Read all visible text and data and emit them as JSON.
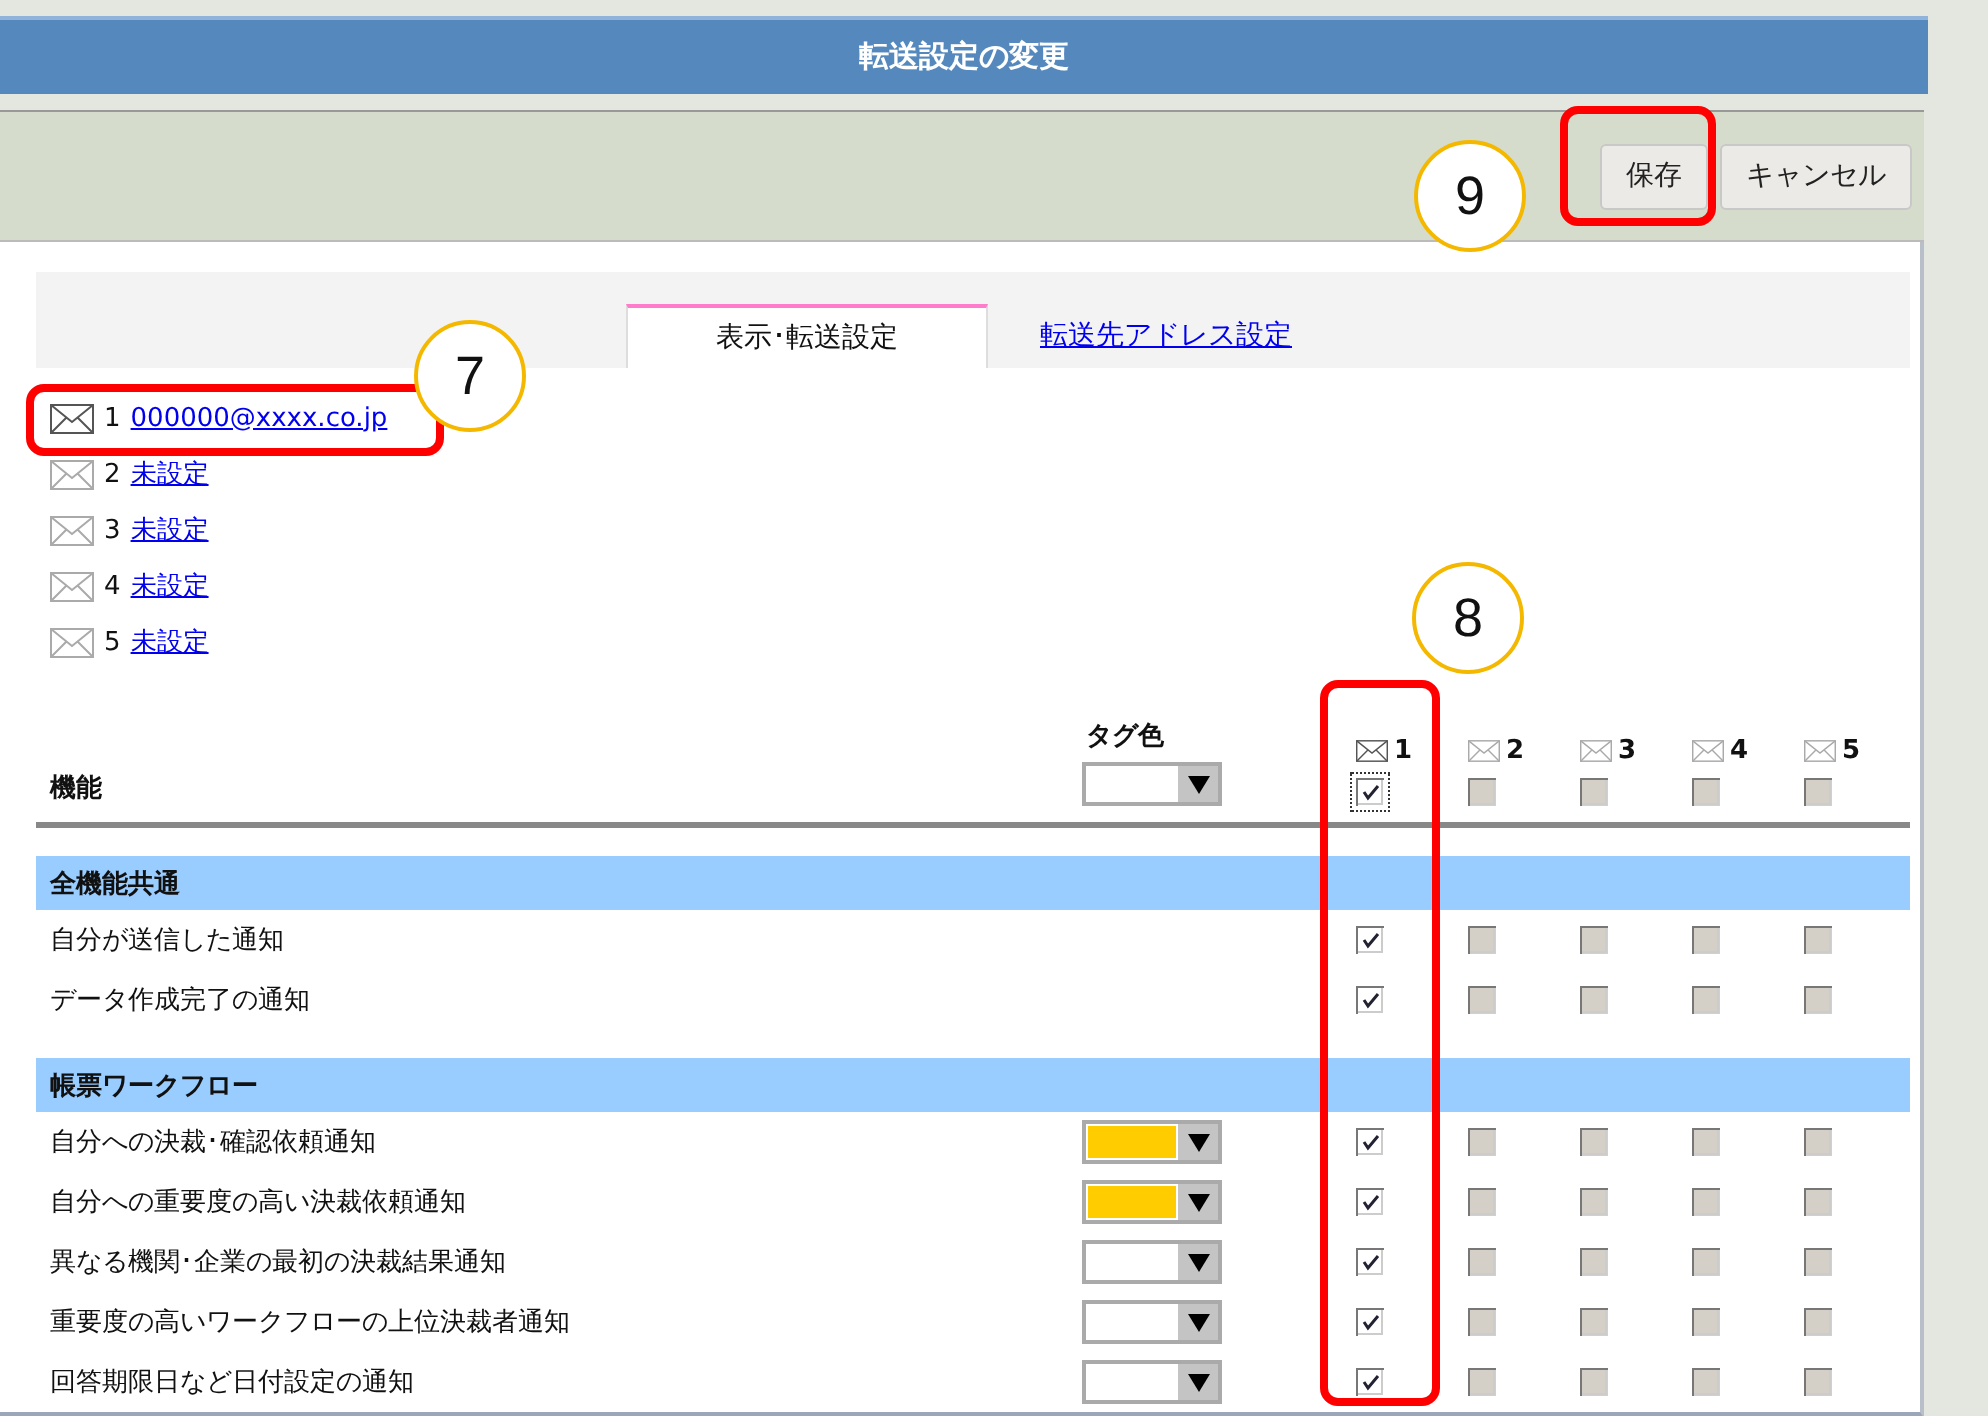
{
  "window": {
    "title": "転送設定の変更"
  },
  "toolbar": {
    "buttons": [
      {
        "label": "保存"
      },
      {
        "label": "キャンセル"
      }
    ]
  },
  "tabs": [
    {
      "label": "表示･転送設定",
      "selected": true
    },
    {
      "label": "転送先アドレス設定",
      "selected": false
    }
  ],
  "addresses": [
    {
      "number": "1",
      "address": "000000@xxxx.co.jp",
      "configured": true
    },
    {
      "number": "2",
      "address": "未設定",
      "configured": false
    },
    {
      "number": "3",
      "address": "未設定",
      "configured": false
    },
    {
      "number": "4",
      "address": "未設定",
      "configured": false
    },
    {
      "number": "5",
      "address": "未設定",
      "configured": false
    }
  ],
  "table": {
    "function_header": "機能",
    "tag_header": "タグ色",
    "header_tag": {
      "color": "#ffffff"
    },
    "columns": [
      {
        "number": "1",
        "configured": true
      },
      {
        "number": "2",
        "configured": false
      },
      {
        "number": "3",
        "configured": false
      },
      {
        "number": "4",
        "configured": false
      },
      {
        "number": "5",
        "configured": false
      }
    ],
    "header_checks": [
      {
        "checked": true,
        "disabled": false,
        "focused": true
      },
      {
        "checked": false,
        "disabled": true
      },
      {
        "checked": false,
        "disabled": true
      },
      {
        "checked": false,
        "disabled": true
      },
      {
        "checked": false,
        "disabled": true
      }
    ],
    "sections": [
      {
        "title": "全機能共通",
        "rows": [
          {
            "label": "自分が送信した通知",
            "checks": [
              {
                "checked": true,
                "disabled": false
              },
              {
                "checked": false,
                "disabled": true
              },
              {
                "checked": false,
                "disabled": true
              },
              {
                "checked": false,
                "disabled": true
              },
              {
                "checked": false,
                "disabled": true
              }
            ]
          },
          {
            "label": "データ作成完了の通知",
            "checks": [
              {
                "checked": true,
                "disabled": false
              },
              {
                "checked": false,
                "disabled": true
              },
              {
                "checked": false,
                "disabled": true
              },
              {
                "checked": false,
                "disabled": true
              },
              {
                "checked": false,
                "disabled": true
              }
            ]
          }
        ]
      },
      {
        "title": "帳票ワークフロー",
        "rows": [
          {
            "label": "自分への決裁･確認依頼通知",
            "tag": {
              "color": "#ffcc00"
            },
            "checks": [
              {
                "checked": true,
                "disabled": false
              },
              {
                "checked": false,
                "disabled": true
              },
              {
                "checked": false,
                "disabled": true
              },
              {
                "checked": false,
                "disabled": true
              },
              {
                "checked": false,
                "disabled": true
              }
            ]
          },
          {
            "label": "自分への重要度の高い決裁依頼通知",
            "tag": {
              "color": "#ffcc00"
            },
            "checks": [
              {
                "checked": true,
                "disabled": false
              },
              {
                "checked": false,
                "disabled": true
              },
              {
                "checked": false,
                "disabled": true
              },
              {
                "checked": false,
                "disabled": true
              },
              {
                "checked": false,
                "disabled": true
              }
            ]
          },
          {
            "label": "異なる機関･企業の最初の決裁結果通知",
            "tag": {
              "color": "#ffffff"
            },
            "checks": [
              {
                "checked": true,
                "disabled": false
              },
              {
                "checked": false,
                "disabled": true
              },
              {
                "checked": false,
                "disabled": true
              },
              {
                "checked": false,
                "disabled": true
              },
              {
                "checked": false,
                "disabled": true
              }
            ]
          },
          {
            "label": "重要度の高いワークフローの上位決裁者通知",
            "tag": {
              "color": "#ffffff"
            },
            "checks": [
              {
                "checked": true,
                "disabled": false
              },
              {
                "checked": false,
                "disabled": true
              },
              {
                "checked": false,
                "disabled": true
              },
              {
                "checked": false,
                "disabled": true
              },
              {
                "checked": false,
                "disabled": true
              }
            ]
          },
          {
            "label": "回答期限日など日付設定の通知",
            "tag": {
              "color": "#ffffff"
            },
            "checks": [
              {
                "checked": true,
                "disabled": false
              },
              {
                "checked": false,
                "disabled": true
              },
              {
                "checked": false,
                "disabled": true
              },
              {
                "checked": false,
                "disabled": true
              },
              {
                "checked": false,
                "disabled": true
              }
            ]
          }
        ]
      }
    ]
  },
  "callouts": [
    {
      "number": "7"
    },
    {
      "number": "8"
    },
    {
      "number": "9"
    }
  ]
}
